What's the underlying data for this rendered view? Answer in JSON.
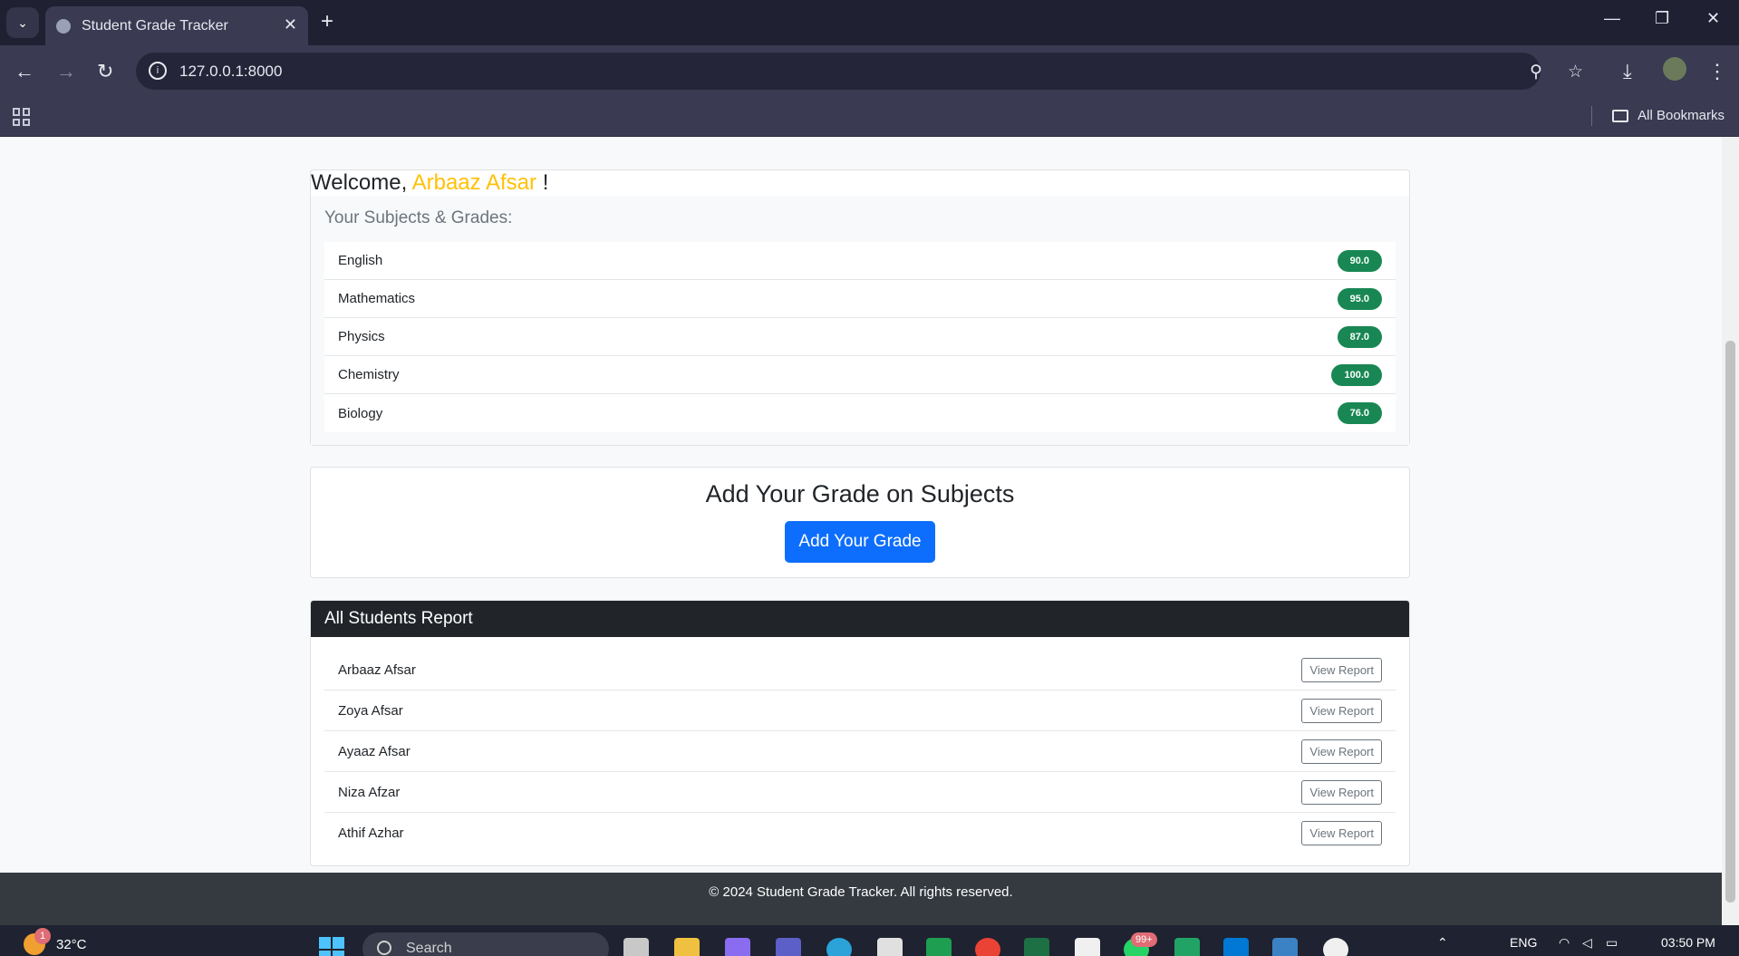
{
  "browser": {
    "tab_title": "Student Grade Tracker",
    "url": "127.0.0.1:8000",
    "bookmarks_label": "All Bookmarks"
  },
  "welcome": {
    "prefix": "Welcome,",
    "name": "Arbaaz Afsar",
    "suffix": "!"
  },
  "subjects": {
    "title": "Your Subjects & Grades:",
    "items": [
      {
        "name": "English",
        "grade": "90.0"
      },
      {
        "name": "Mathematics",
        "grade": "95.0"
      },
      {
        "name": "Physics",
        "grade": "87.0"
      },
      {
        "name": "Chemistry",
        "grade": "100.0"
      },
      {
        "name": "Biology",
        "grade": "76.0"
      }
    ]
  },
  "add_grade": {
    "title": "Add Your Grade on Subjects",
    "button": "Add Your Grade"
  },
  "report": {
    "title": "All Students Report",
    "button_label": "View Report",
    "students": [
      "Arbaaz Afsar",
      "Zoya Afsar",
      "Ayaaz Afsar",
      "Niza Afzar",
      "Athif Azhar"
    ]
  },
  "footer": {
    "text": "© 2024 Student Grade Tracker. All rights reserved."
  },
  "taskbar": {
    "temperature": "32°C",
    "weather_badge": "1",
    "search_placeholder": "Search",
    "app_badge": "99+",
    "language": "ENG",
    "time": "03:50 PM"
  },
  "colors": {
    "accent_name": "#ffc107",
    "badge": "#198754",
    "primary_button": "#0d6efd",
    "report_header": "#212529",
    "footer": "#343a40"
  }
}
